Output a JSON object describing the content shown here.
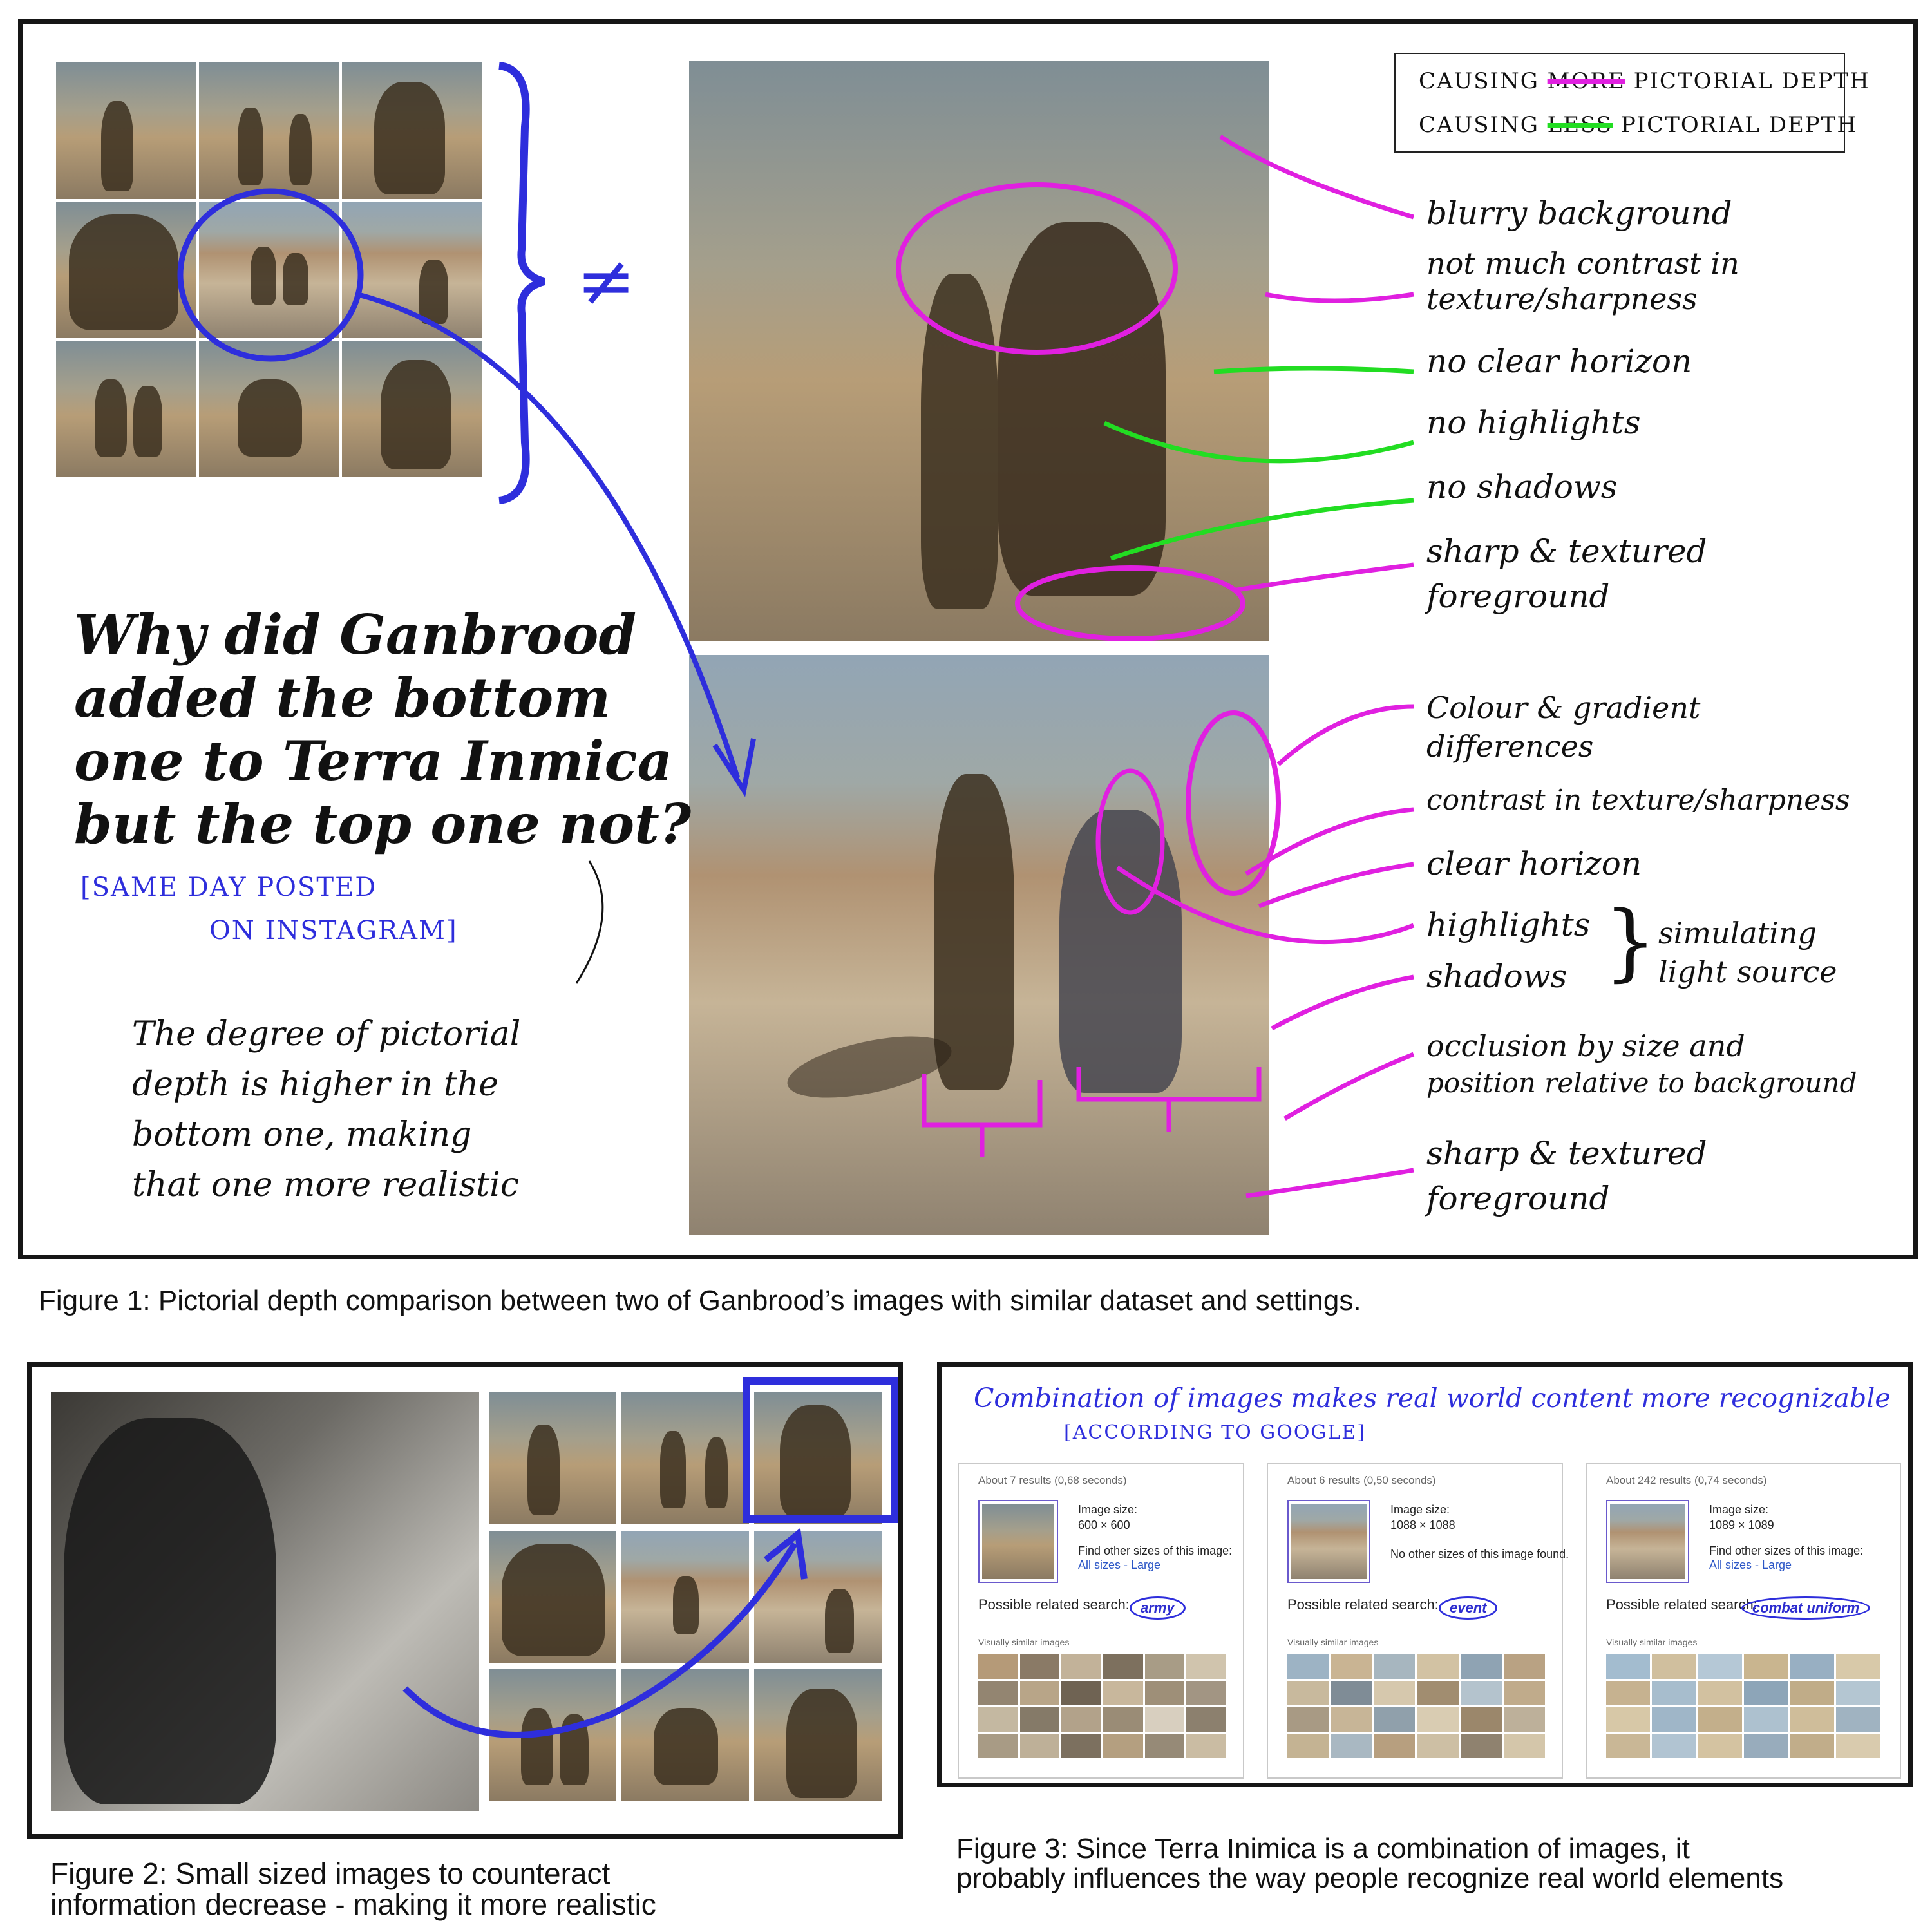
{
  "figure1": {
    "legend": {
      "more_prefix": "CAUSING",
      "more_strike": "MORE",
      "more_suffix": "PICTORIAL DEPTH",
      "less_prefix": "CAUSING",
      "less_strike": "LESS",
      "less_suffix": "PICTORIAL DEPTH",
      "more_color": "#e020e0",
      "less_color": "#22dd22"
    },
    "not_equal": "≠",
    "question": [
      "Why did Ganbrood",
      "added the bottom",
      "one to Terra Inmica",
      "but the top one not?"
    ],
    "source_note": [
      "[SAME DAY POSTED",
      "ON INSTAGRAM]"
    ],
    "conclusion": [
      "The degree of pictorial",
      "depth is higher in the",
      "bottom one, making",
      "that one more realistic"
    ],
    "top_notes": [
      "blurry background",
      "not much contrast in",
      "texture/sharpness",
      "no clear horizon",
      "no highlights",
      "no shadows",
      "sharp & textured",
      "foreground"
    ],
    "bottom_notes": [
      "Colour & gradient",
      "differences",
      "contrast in texture/sharpness",
      "clear horizon",
      "highlights",
      "shadows",
      "simulating",
      "light source",
      "occlusion by size and",
      "position relative to background",
      "sharp & textured",
      "foreground"
    ],
    "caption": "Figure 1: Pictorial depth comparison between two of Ganbrood’s images with similar dataset and settings."
  },
  "figure2": {
    "caption_line1": "Figure 2: Small sized images to counteract",
    "caption_line2": "information decrease - making it more realistic"
  },
  "figure3": {
    "title": "Combination of images makes real world content more recognizable",
    "subtitle": "[ACCORDING TO GOOGLE]",
    "cards": [
      {
        "results": "About 7 results (0,68 seconds)",
        "size_label": "Image size:",
        "size": "600 × 600",
        "other": "Find other sizes of this image:",
        "links": "All sizes - Large",
        "related_label": "Possible related search:",
        "term": "army",
        "similar": "Visually similar images"
      },
      {
        "results": "About 6 results (0,50 seconds)",
        "size_label": "Image size:",
        "size": "1088 × 1088",
        "other": "No other sizes of this image found.",
        "links": "",
        "related_label": "Possible related search:",
        "term": "event",
        "similar": "Visually similar images"
      },
      {
        "results": "About 242 results (0,74 seconds)",
        "size_label": "Image size:",
        "size": "1089 × 1089",
        "other": "Find other sizes of this image:",
        "links": "All sizes - Large",
        "related_label": "Possible related search:",
        "term": "combat uniform",
        "similar": "Visually similar images"
      }
    ],
    "caption_line1": "Figure 3: Since Terra Inimica is a combination of images, it",
    "caption_line2": "probably influences the way people recognize real world elements"
  },
  "colors": {
    "pen_blue": "#2e2edc",
    "pen_magenta": "#e020e0",
    "pen_green": "#22dd22"
  }
}
